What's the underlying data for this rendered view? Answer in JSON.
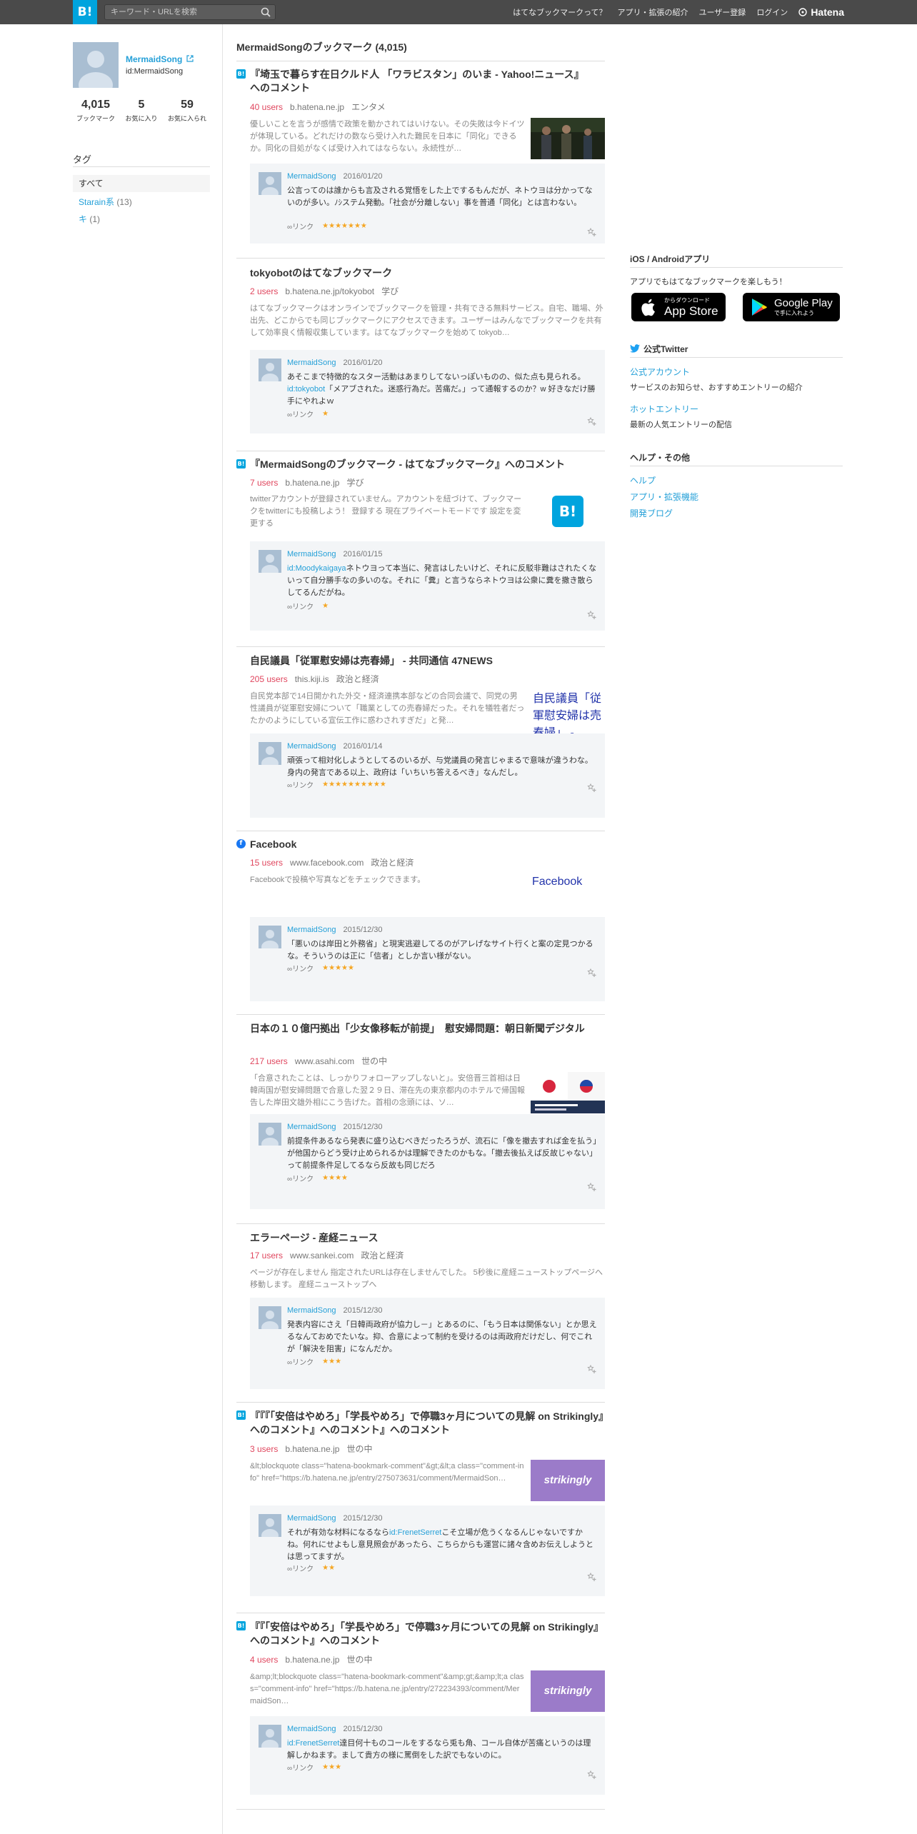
{
  "header": {
    "logo": "B!",
    "search_placeholder": "キーワード・URLを検索",
    "nav": [
      "はてなブックマークって？",
      "アプリ・拡張の紹介",
      "ユーザー登録",
      "ログイン"
    ],
    "brand": "Hatena"
  },
  "profile": {
    "name": "MermaidSong",
    "id": "id:MermaidSong",
    "stats": [
      {
        "value": "4,015",
        "label": "ブックマーク"
      },
      {
        "value": "5",
        "label": "お気に入り"
      },
      {
        "value": "59",
        "label": "お気に入られ"
      }
    ]
  },
  "tags": {
    "heading": "タグ",
    "all_label": "すべて",
    "items": [
      {
        "name": "Starain系",
        "count": "(13)"
      },
      {
        "name": "キ",
        "count": "(1)"
      }
    ]
  },
  "main": {
    "title": "MermaidSongのブックマーク (4,015)",
    "entries": [
      {
        "title": "『埼玉で暮らす在日クルド人 「ワラビスタン」のいま - Yahoo!ニュース』へのコメント",
        "users": "40 users",
        "domain": "b.hatena.ne.jp",
        "category": "エンタメ",
        "summary": "優しいことを言うが感情で政策を動かされてはいけない。その失敗は今ドイツが体現している。どれだけの数なら受け入れた難民を日本に「同化」できるか。同化の目処がなくば受け入れてはならない。永続性が…",
        "comment_user": "MermaidSong",
        "comment_date": "2016/01/20",
        "comment_text": "公言ってのは誰からも言及される覚悟をした上でするもんだが、ネトウヨは分かってないのが多い。ﾉｼステム発動。「社会が分離しない」事を普通「同化」とは言わない。",
        "link_label": "∞リンク",
        "stars": "★★★★★★★"
      },
      {
        "title": "tokyobotのはてなブックマーク",
        "users": "2 users",
        "domain": "b.hatena.ne.jp/tokyobot",
        "category": "学び",
        "summary": "はてなブックマークはオンラインでブックマークを管理・共有できる無料サービス。自宅、職場、外出先、どこからでも同じブックマークにアクセスできます。ユーザーはみんなでブックマークを共有して効率良く情報収集しています。はてなブックマークを始めて tokyob…",
        "comment_user": "MermaidSong",
        "comment_date": "2016/01/20",
        "comment_pre": "あそこまで特徴的なスター活動はあまりしてないっぽいものの、似た点も見られる。",
        "comment_link": "id:tokyobot",
        "comment_post": "「メアブされた。迷惑行為だ。苦痛だ。」って通報するのか？w 好きなだけ勝手にやれよｗ",
        "link_label": "∞リンク",
        "stars": "★"
      },
      {
        "title": "『MermaidSongのブックマーク - はてなブックマーク』へのコメント",
        "users": "7 users",
        "domain": "b.hatena.ne.jp",
        "category": "学び",
        "summary": "twitterアカウントが登録されていません。アカウントを紐づけて、ブックマークをtwitterにも投稿しよう！ 登録する 現在プライベートモードです 設定を変更する",
        "thumb_label": "B!",
        "comment_user": "MermaidSong",
        "comment_date": "2016/01/15",
        "comment_link": "id:Moodykaigaya",
        "comment_post": "ネトウヨって本当に、発言はしたいけど、それに反駁非難はされたくないって自分勝手なの多いのな。それに「糞」と言うならネトウヨは公衆に糞を撒き散らしてるんだがね。",
        "link_label": "∞リンク",
        "stars": "★"
      },
      {
        "title": "自民議員「従軍慰安婦は売春婦」 - 共同通信 47NEWS",
        "users": "205 users",
        "domain": "this.kiji.is",
        "category": "政治と経済",
        "summary": "自民党本部で14日開かれた外交・経済連携本部などの合同会議で、同党の男性議員が従軍慰安婦について「職業としての売春婦だった。それを犠牲者だったかのようにしている宣伝工作に惑わされすぎだ」と発…",
        "thumb_alt": "自民議員「従軍慰安婦は売春婦」 -",
        "comment_user": "MermaidSong",
        "comment_date": "2016/01/14",
        "comment_text": "頑張って相対化しようとしてるのいるが、与党議員の発言じゃまるで意味が違うわな。身内の発言である以上、政府は「いちいち答えるべき」なんだし。",
        "link_label": "∞リンク",
        "stars": "★★★★★★★★★★"
      },
      {
        "title": "Facebook",
        "users": "15 users",
        "domain": "www.facebook.com",
        "category": "政治と経済",
        "summary": "Facebookで投稿や写真などをチェックできます。",
        "thumb_alt": "Facebook",
        "comment_user": "MermaidSong",
        "comment_date": "2015/12/30",
        "comment_text": "「悪いのは岸田と外務省」と現実逃避してるのがアレげなサイト行くと案の定見つかるな。そういうのは正に「信者」としか言い様がない。",
        "link_label": "∞リンク",
        "stars": "★★★★★"
      },
      {
        "title": "日本の１０億円拠出「少女像移転が前提」　慰安婦問題：朝日新聞デジタル",
        "users": "217 users",
        "domain": "www.asahi.com",
        "category": "世の中",
        "summary": "「合意されたことは、しっかりフォローアップしないと」。安倍晋三首相は日韓両国が慰安婦問題で合意した翌２９日、滞在先の東京都内のホテルで帰国報告した岸田文雄外相にこう告げた。首相の念頭には、ソ…",
        "comment_user": "MermaidSong",
        "comment_date": "2015/12/30",
        "comment_text": "前提条件あるなら発表に盛り込むべきだったろうが、流石に「像を撤去すれば金を払う」が他国からどう受け止められるかは理解できたのかもな。「撤去後払えば反故じゃない」って前提条件足してるなら反故も同じだろ",
        "link_label": "∞リンク",
        "stars": "★★★★"
      },
      {
        "title": "エラーページ - 産経ニュース",
        "users": "17 users",
        "domain": "www.sankei.com",
        "category": "政治と経済",
        "summary": "ページが存在しません 指定されたURLは存在しませんでした。 5秒後に産経ニューストップページへ移動します。 産経ニューストップへ",
        "comment_user": "MermaidSong",
        "comment_date": "2015/12/30",
        "comment_text": "発表内容にさえ「日韓両政府が協力し－」とあるのに、「もう日本は関係ない」とか思えるなんておめでたいな。抑、合意によって制約を受けるのは両政府だけだし、何でこれが「解決を阻害」になんだか。",
        "link_label": "∞リンク",
        "stars": "★★★"
      },
      {
        "title": "『『『「安倍はやめろ」「学長やめろ」で停職3ヶ月についての見解 on Strikingly』へのコメント』へのコメント』へのコメント",
        "users": "3 users",
        "domain": "b.hatena.ne.jp",
        "category": "世の中",
        "summary": "&lt;blockquote class=\"hatena-bookmark-comment\"&gt;&lt;a class=\"comment-info\" href=\"https://b.hatena.ne.jp/entry/275073631/comment/MermaidSon…",
        "thumb_label": "strikingly",
        "comment_user": "MermaidSong",
        "comment_date": "2015/12/30",
        "comment_pre": "それが有効な材料になるなら",
        "comment_link": "id:FrenetSerret",
        "comment_post": "こそ立場が危うくなるんじゃないですかね。何れにせよもし意見照会があったら、こちらからも運営に諸々含めお伝えしようとは思ってますが。",
        "link_label": "∞リンク",
        "stars": "★★"
      },
      {
        "title": "『『「安倍はやめろ」「学長やめろ」で停職3ヶ月についての見解 on Strikingly』へのコメント』へのコメント",
        "users": "4 users",
        "domain": "b.hatena.ne.jp",
        "category": "世の中",
        "summary": "&amp;lt;blockquote class=\"hatena-bookmark-comment\"&amp;gt;&amp;lt;a class=\"comment-info\" href=\"https://b.hatena.ne.jp/entry/272234393/comment/MermaidSon…",
        "thumb_label": "strikingly",
        "comment_user": "MermaidSong",
        "comment_date": "2015/12/30",
        "comment_link": "id:FrenetSerret",
        "comment_post": "達目何十ものコールをするなら兎も角、コール自体が苦痛というのは理解しかねます。まして貴方の様に罵倒をした訳でもないのに。",
        "link_label": "∞リンク",
        "stars": "★★★"
      }
    ]
  },
  "right": {
    "apps_heading": "iOS / Androidアプリ",
    "apps_text": "アプリでもはてなブックマークを楽しもう！",
    "appstore_small": "からダウンロード",
    "appstore_big": "App Store",
    "gplay_big": "Google Play",
    "gplay_small": "で手に入れよう",
    "twitter_heading": "公式Twitter",
    "twitter_links": [
      {
        "label": "公式アカウント",
        "desc": "サービスのお知らせ、おすすめエントリーの紹介"
      },
      {
        "label": "ホットエントリー",
        "desc": "最新の人気エントリーの配信"
      }
    ],
    "help_heading": "ヘルプ・その他",
    "help_links": [
      "ヘルプ",
      "アプリ・拡張機能",
      "開発ブログ"
    ]
  },
  "colors": {
    "header_bg": "#4a4a4a",
    "brand_blue": "#00a4de",
    "link": "#25a0d8",
    "users_red": "#e0465e",
    "star": "#f5a623",
    "comment_bg": "#f3f5f7",
    "strikingly": "#9b7bc9"
  },
  "icons": [
    "search-icon",
    "external-link-icon",
    "hatena-bookmark-favicon",
    "facebook-favicon",
    "add-bookmark-icon",
    "apple-icon",
    "google-play-icon",
    "twitter-bird-icon",
    "hatena-logo-icon"
  ]
}
